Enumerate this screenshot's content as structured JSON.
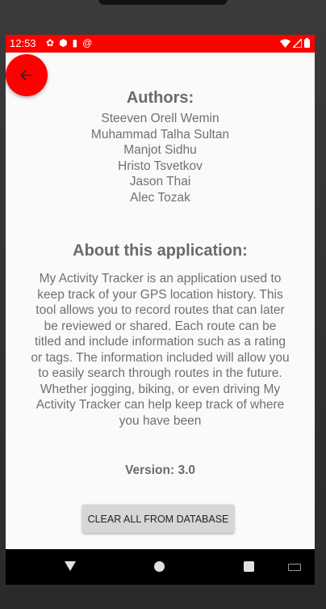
{
  "status_bar": {
    "time": "12:53",
    "color": "#ff0000",
    "icons": [
      "settings-icon",
      "shield-icon",
      "sd-card-icon",
      "at-icon"
    ],
    "right_icons": [
      "wifi-icon",
      "signal-icon",
      "battery-icon"
    ]
  },
  "back_button": {
    "icon": "arrow-left-icon",
    "color": "#ff0000"
  },
  "authors": {
    "title": "Authors:",
    "names": [
      "Steeven Orell Wemin",
      "Muhammad Talha Sultan",
      "Manjot Sidhu",
      "Hristo Tsvetkov",
      "Jason Thai",
      "Alec Tozak"
    ]
  },
  "about": {
    "title": "About this application:",
    "text": "My Activity Tracker is an application used to keep track of your GPS location history. This tool allows you to record routes that can later be reviewed or shared. Each route can be titled and include information such as a rating or tags. The information included will allow you to easily search through routes in the future. Whether jogging, biking, or even driving My Activity Tracker can help keep track of where you have been"
  },
  "version": "Version: 3.0",
  "clear_button": {
    "label": "CLEAR ALL FROM DATABASE"
  },
  "nav_bar": {
    "icons": [
      "nav-back-icon",
      "nav-home-icon",
      "nav-recents-icon",
      "keyboard-icon"
    ]
  }
}
